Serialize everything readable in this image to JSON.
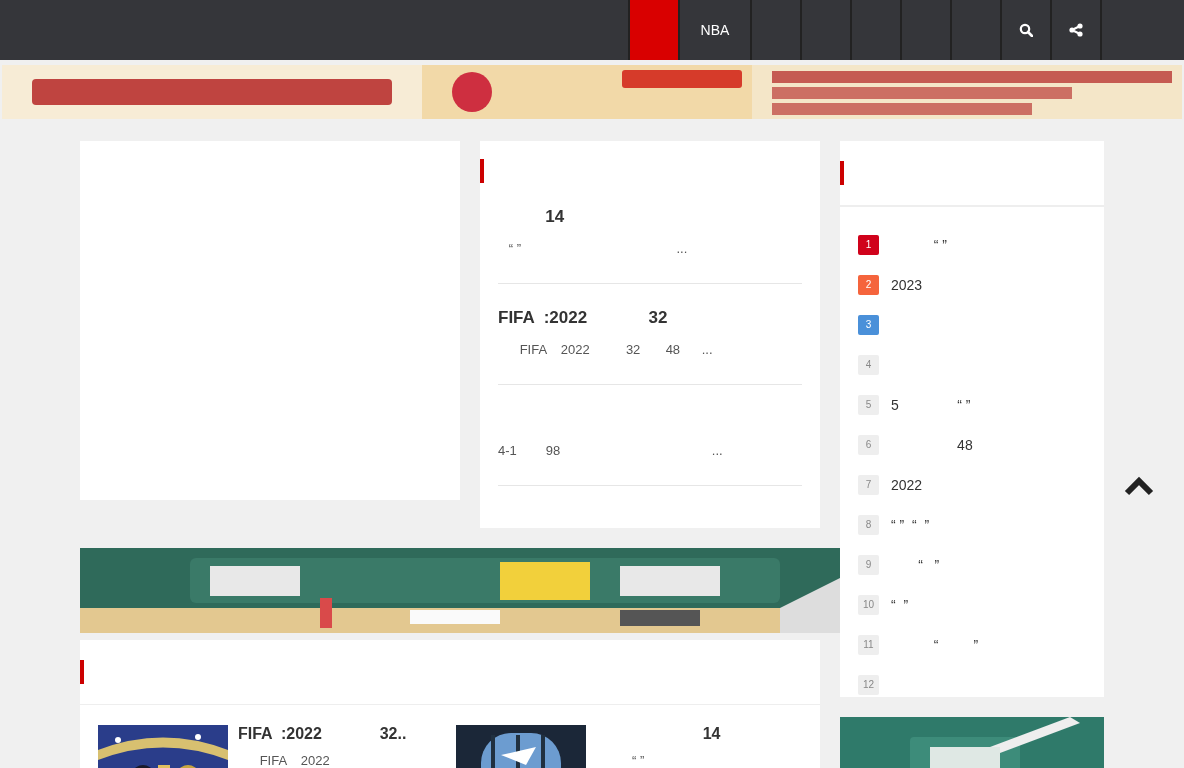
{
  "nav": {
    "items": [
      {
        "selected": true
      },
      {
        "label": "NBA",
        "selected": false
      },
      {
        "selected": false
      },
      {
        "selected": false
      },
      {
        "selected": false
      },
      {
        "selected": false
      },
      {
        "selected": false
      }
    ]
  },
  "featured": {
    "articles": [
      {
        "title": "          14",
        "summary": "   “ ”                                           ..."
      },
      {
        "title": "FIFA  :2022             32",
        "summary": "      FIFA    2022          32       48      ..."
      },
      {
        "summary": "4-1        98                                          ..."
      }
    ]
  },
  "ranking": {
    "items": [
      {
        "rank": "1",
        "color": "#d0021b",
        "text": "           “ ”"
      },
      {
        "rank": "2",
        "color": "#f5643c",
        "text": "2023"
      },
      {
        "rank": "3",
        "color": "#4a90d9"
      },
      {
        "rank": "4",
        "color": "#eeeeee"
      },
      {
        "rank": "5",
        "color": "#eeeeee",
        "text": "5               “ ”"
      },
      {
        "rank": "6",
        "color": "#eeeeee",
        "text": "                 48"
      },
      {
        "rank": "7",
        "color": "#eeeeee",
        "text": "2022"
      },
      {
        "rank": "8",
        "color": "#eeeeee",
        "text": "“ ”  “  ”"
      },
      {
        "rank": "9",
        "color": "#eeeeee",
        "text": "       “   ”"
      },
      {
        "rank": "10",
        "color": "#eeeeee",
        "text": "“  ”"
      },
      {
        "rank": "11",
        "color": "#eeeeee",
        "text": "           “         ”"
      },
      {
        "rank": "12",
        "color": "#eeeeee"
      }
    ]
  },
  "news": {
    "items": [
      {
        "title": "FIFA  :2022             32..",
        "summary": "      FIFA    2022"
      },
      {
        "title": "                        14",
        "summary": "          “ ”"
      }
    ]
  }
}
